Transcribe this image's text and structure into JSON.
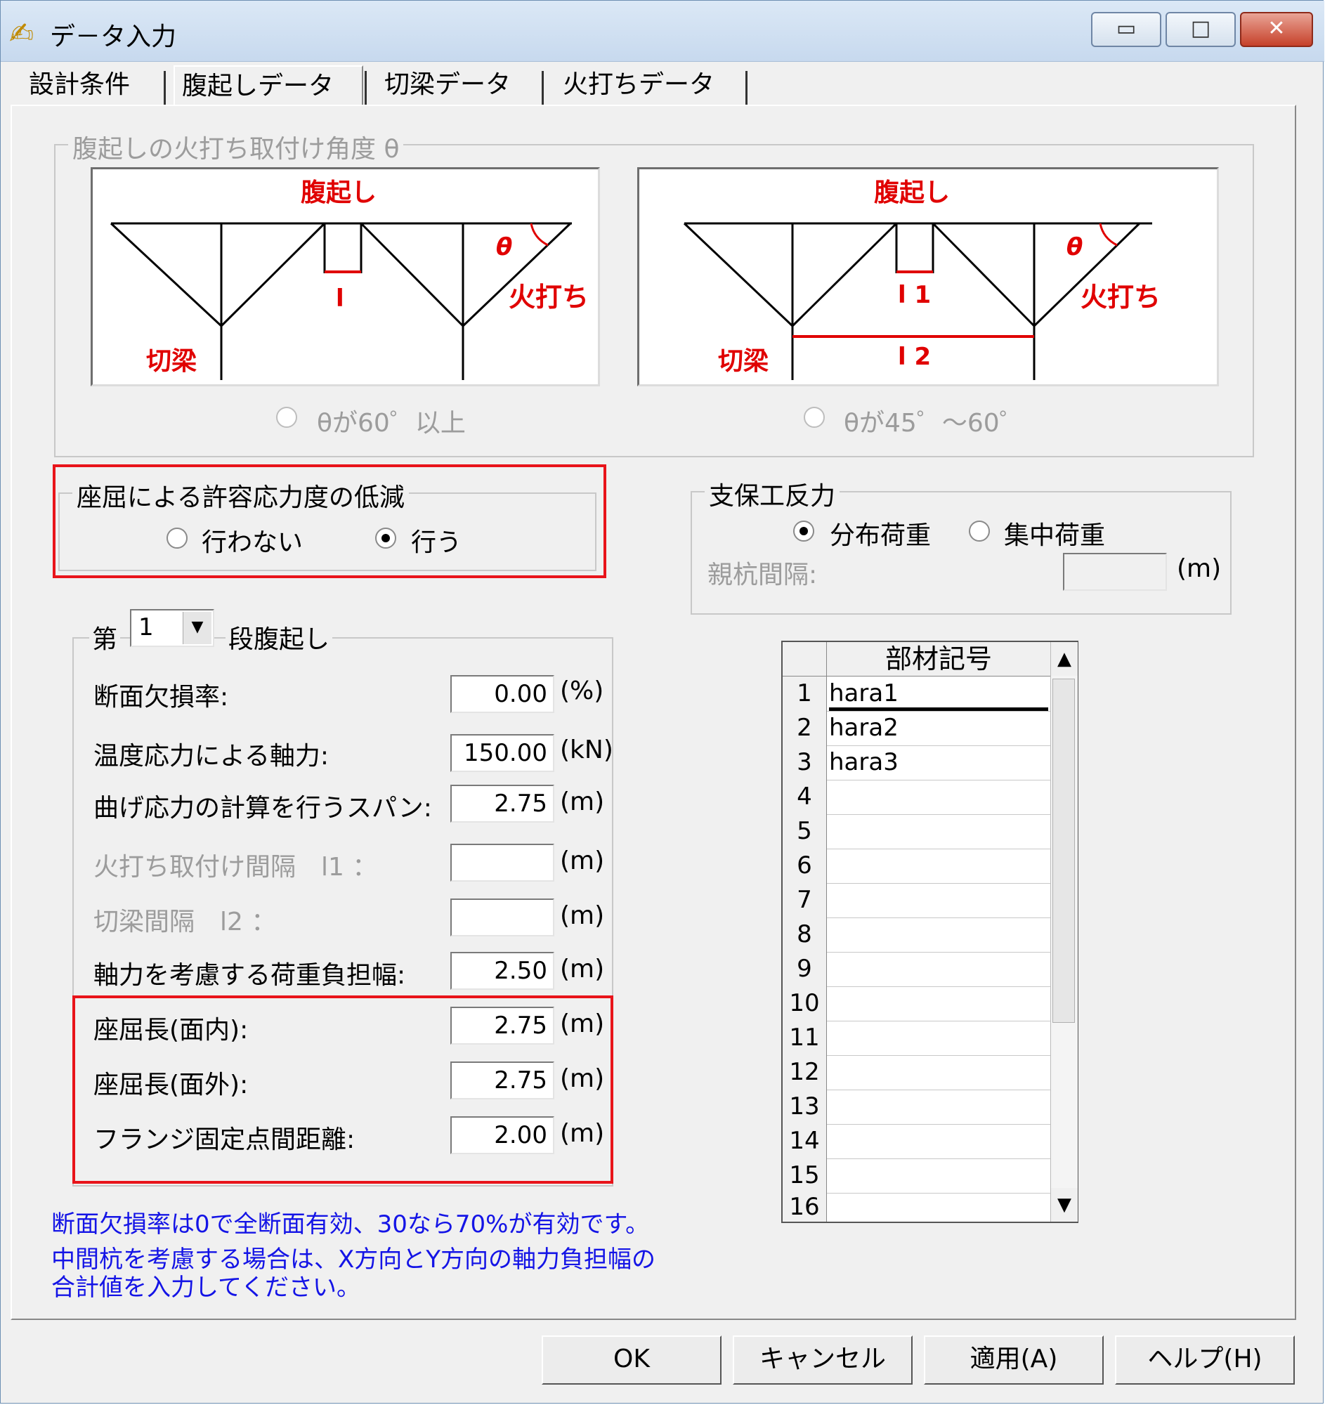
{
  "window": {
    "title": "デ－タ入力",
    "icon": "edit-pencil-icon",
    "controls": [
      "minimize-icon",
      "maximize-icon",
      "close-icon"
    ]
  },
  "tabs": [
    {
      "label": "設計条件",
      "active": false
    },
    {
      "label": "腹起しデータ",
      "active": true
    },
    {
      "label": "切梁データ",
      "active": false
    },
    {
      "label": "火打ちデータ",
      "active": false
    }
  ],
  "angle_group": {
    "title": "腹起しの火打ち取付け角度 θ",
    "diagram1": {
      "top": "腹起し",
      "theta": "θ",
      "span": "l",
      "hiuchi": "火打ち",
      "kiribari": "切梁"
    },
    "diagram2": {
      "top": "腹起し",
      "theta": "θ",
      "span1": "l 1",
      "span2": "l 2",
      "hiuchi": "火打ち",
      "kiribari": "切梁"
    },
    "option1": "θが60゜以上",
    "option2": "θが45゜～60゜"
  },
  "buckling_group": {
    "title": "座屈による許容応力度の低減",
    "option_no": "行わない",
    "option_yes": "行う",
    "selected": "行う"
  },
  "support_group": {
    "title": "支保工反力",
    "option_distributed": "分布荷重",
    "option_concentrated": "集中荷重",
    "selected": "分布荷重",
    "pile_spacing_label": "親杭間隔:",
    "pile_spacing_value": "",
    "pile_spacing_unit": "(m)"
  },
  "stage_group": {
    "prefix": "第",
    "stage_value": "1",
    "suffix": "段腹起し",
    "fields": [
      {
        "label": "断面欠損率:",
        "value": "0.00",
        "unit": "(%)",
        "disabled": false
      },
      {
        "label": "温度応力による軸力:",
        "value": "150.00",
        "unit": "(kN)",
        "disabled": false
      },
      {
        "label": "曲げ応力の計算を行うスパン:",
        "value": "2.75",
        "unit": "(m)",
        "disabled": false
      },
      {
        "label": "火打ち取付け間隔　l1 ：",
        "value": "",
        "unit": "(m)",
        "disabled": true
      },
      {
        "label": "切梁間隔　l2 ：",
        "value": "",
        "unit": "(m)",
        "disabled": true
      },
      {
        "label": "軸力を考慮する荷重負担幅:",
        "value": "2.50",
        "unit": "(m)",
        "disabled": false
      },
      {
        "label": "座屈長(面内):",
        "value": "2.75",
        "unit": "(m)",
        "disabled": false
      },
      {
        "label": "座屈長(面外):",
        "value": "2.75",
        "unit": "(m)",
        "disabled": false
      },
      {
        "label": "フランジ固定点間距離:",
        "value": "2.00",
        "unit": "(m)",
        "disabled": false
      }
    ]
  },
  "member_grid": {
    "header": "部材記号",
    "rows": [
      {
        "num": "1",
        "value": "hara1"
      },
      {
        "num": "2",
        "value": "hara2"
      },
      {
        "num": "3",
        "value": "hara3"
      },
      {
        "num": "4",
        "value": ""
      },
      {
        "num": "5",
        "value": ""
      },
      {
        "num": "6",
        "value": ""
      },
      {
        "num": "7",
        "value": ""
      },
      {
        "num": "8",
        "value": ""
      },
      {
        "num": "9",
        "value": ""
      },
      {
        "num": "10",
        "value": ""
      },
      {
        "num": "11",
        "value": ""
      },
      {
        "num": "12",
        "value": ""
      },
      {
        "num": "13",
        "value": ""
      },
      {
        "num": "14",
        "value": ""
      },
      {
        "num": "15",
        "value": ""
      },
      {
        "num": "16",
        "value": ""
      }
    ]
  },
  "notes": {
    "line1": "断面欠損率は0で全断面有効、30なら70%が有効です。",
    "line2": "中間杭を考慮する場合は、X方向とY方向の軸力負担幅の",
    "line3": "合計値を入力してください。"
  },
  "buttons": {
    "ok": "OK",
    "cancel": "キャンセル",
    "apply": "適用(A)",
    "help": "ヘルプ(H)"
  },
  "colors": {
    "highlight_box": "#e8141a",
    "diagram_label": "#e00000",
    "note_text": "#1414e6"
  }
}
